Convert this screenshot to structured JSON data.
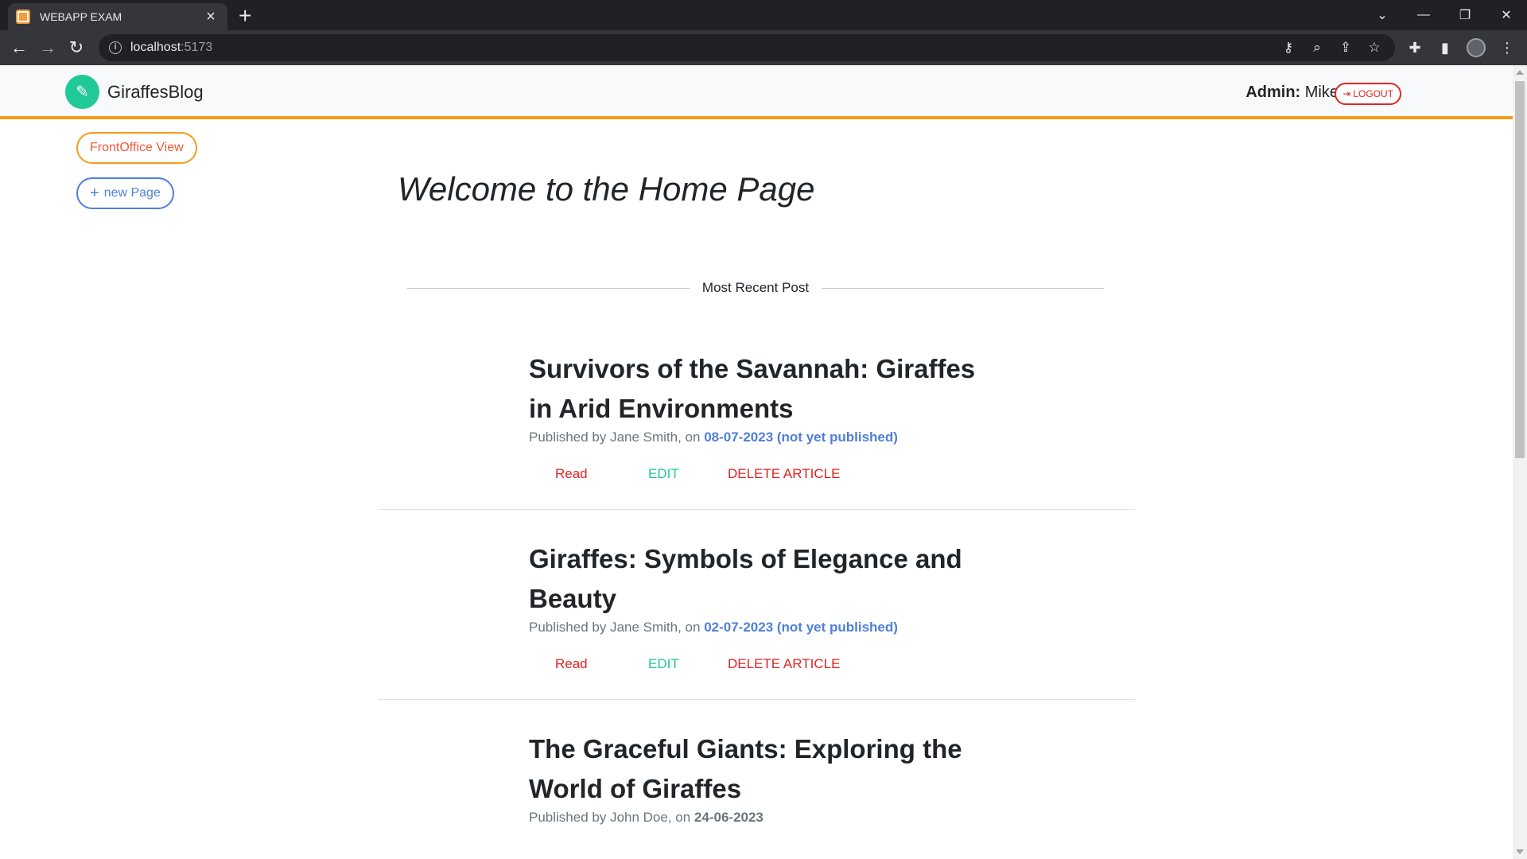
{
  "browser": {
    "tab_title": "WEBAPP EXAM",
    "url_host": "localhost",
    "url_port": ":5173"
  },
  "navbar": {
    "brand": "GiraffesBlog",
    "admin_label": "Admin:",
    "admin_name": "Mike",
    "logout_label": "LOGOUT"
  },
  "sidebar": {
    "frontoffice_label": "FrontOffice View",
    "new_page_label": "new Page"
  },
  "main": {
    "heading": "Welcome to the Home Page",
    "divider_label": "Most Recent Post"
  },
  "posts": [
    {
      "title": "Survivors of the Savannah: Giraffes in Arid Environments",
      "meta_prefix": "Published by Jane Smith, on ",
      "date": "08-07-2023",
      "status": " (not yet published)",
      "read": "Read",
      "edit": "EDIT",
      "delete": "DELETE ARTICLE"
    },
    {
      "title": "Giraffes: Symbols of Elegance and Beauty",
      "meta_prefix": "Published by Jane Smith, on ",
      "date": "02-07-2023",
      "status": " (not yet published)",
      "read": "Read",
      "edit": "EDIT",
      "delete": "DELETE ARTICLE"
    },
    {
      "title": "The Graceful Giants: Exploring the World of Giraffes",
      "meta_prefix": "Published by John Doe, on ",
      "date": "24-06-2023"
    }
  ],
  "colors": {
    "accent_orange": "#f49b1c",
    "brand_green": "#20c997",
    "danger_red": "#e02424",
    "link_blue": "#4e7fd9"
  }
}
